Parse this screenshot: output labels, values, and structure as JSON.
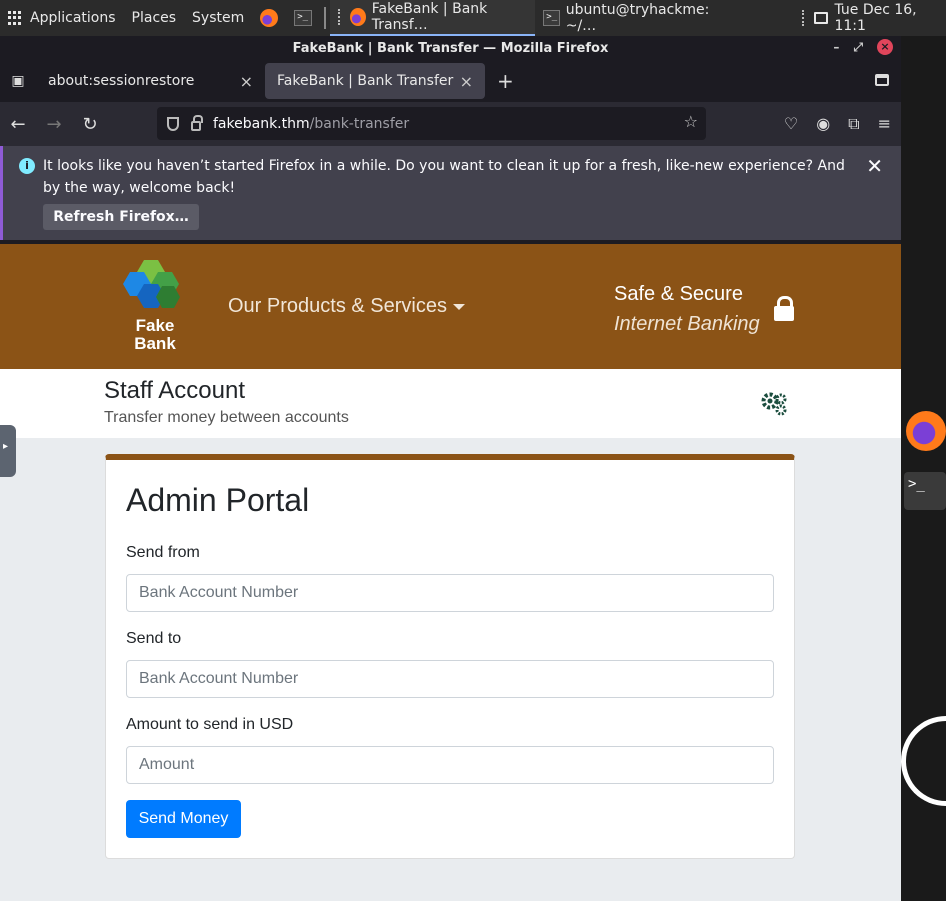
{
  "panel": {
    "applications": "Applications",
    "places": "Places",
    "system": "System",
    "task_firefox": "FakeBank | Bank Transf…",
    "task_terminal": "ubuntu@tryhackme: ~/…",
    "clock": "Tue Dec 16, 11:1"
  },
  "browser": {
    "window_title": "FakeBank | Bank Transfer — Mozilla Firefox",
    "tabs": [
      {
        "label": "about:sessionrestore"
      },
      {
        "label": "FakeBank | Bank Transfer"
      }
    ],
    "url_domain": "fakebank.thm",
    "url_path": "/bank-transfer",
    "notification": "It looks like you haven’t started Firefox in a while. Do you want to clean it up for a fresh, like-new experience? And by the way, welcome back!",
    "refresh_button": "Refresh Firefox…"
  },
  "site": {
    "logo_text_line1": "Fake",
    "logo_text_line2": "Bank",
    "nav_products": "Our Products & Services",
    "tagline_line1": "Safe & Secure",
    "tagline_line2": "Internet Banking",
    "account_title": "Staff Account",
    "account_subtitle": "Transfer money between accounts",
    "colors": {
      "brand": "#8b5316",
      "primary": "#007bff"
    }
  },
  "form": {
    "heading": "Admin Portal",
    "send_from_label": "Send from",
    "send_from_placeholder": "Bank Account Number",
    "send_to_label": "Send to",
    "send_to_placeholder": "Bank Account Number",
    "amount_label": "Amount to send in USD",
    "amount_placeholder": "Amount",
    "submit": "Send Money"
  }
}
